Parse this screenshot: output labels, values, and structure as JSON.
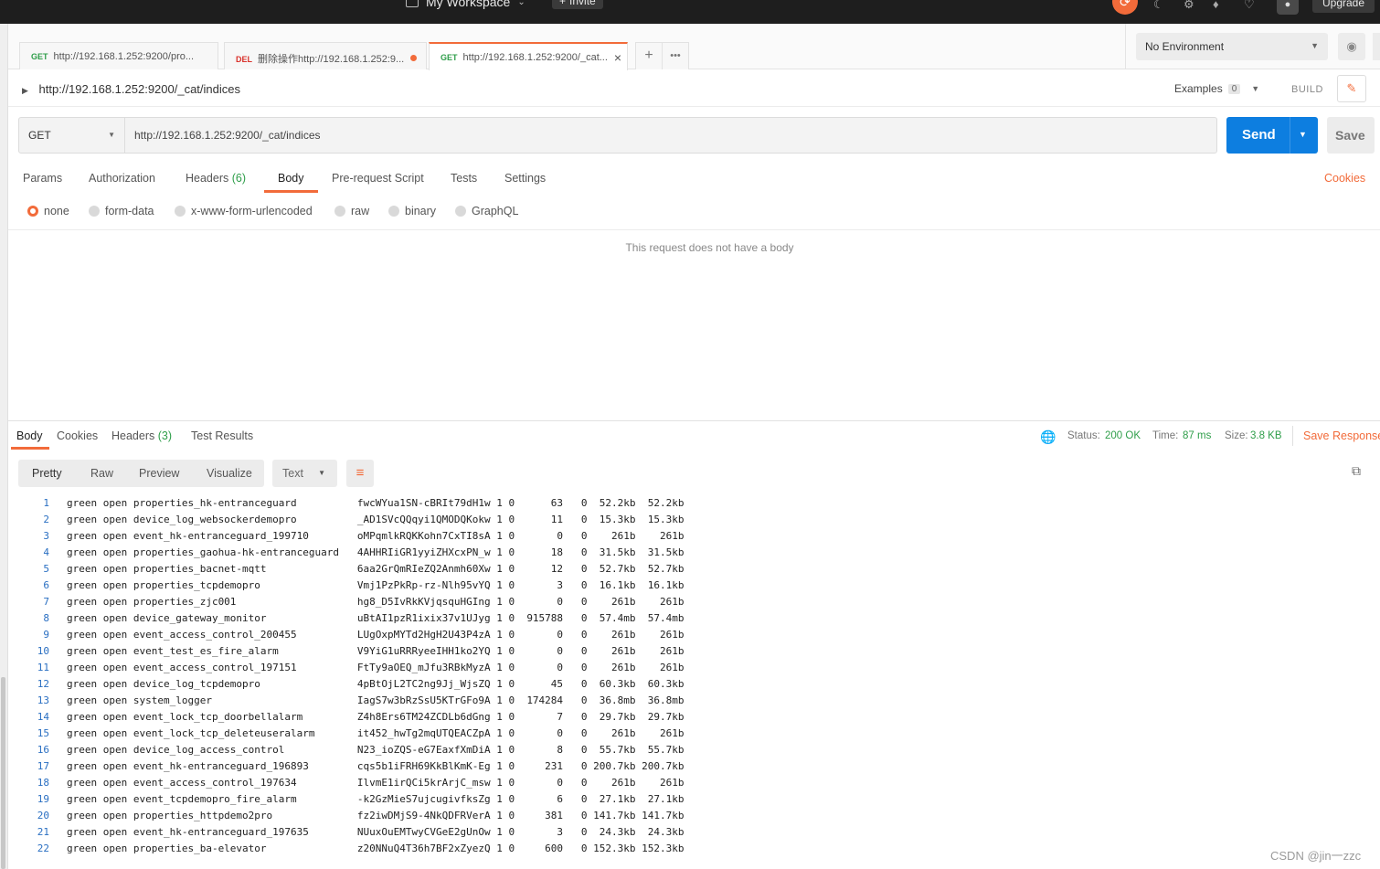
{
  "topbar": {
    "workspace": "My Workspace",
    "invite": "Invite",
    "upgrade": "Upgrade"
  },
  "tabs": [
    {
      "method": "GET",
      "title": "http://192.168.1.252:9200/pro..."
    },
    {
      "method": "DEL",
      "title": "删除操作http://192.168.1.252:9..."
    },
    {
      "method": "GET",
      "title": "http://192.168.1.252:9200/_cat..."
    }
  ],
  "environment": {
    "selected": "No Environment"
  },
  "request": {
    "name": "http://192.168.1.252:9200/_cat/indices",
    "examples_label": "Examples",
    "examples_count": "0",
    "build_label": "BUILD",
    "method": "GET",
    "url": "http://192.168.1.252:9200/_cat/indices",
    "send_label": "Send",
    "save_label": "Save"
  },
  "request_tabs": {
    "params": "Params",
    "authorization": "Authorization",
    "headers": "Headers",
    "headers_count": "(6)",
    "body": "Body",
    "prerequest": "Pre-request Script",
    "tests": "Tests",
    "settings": "Settings",
    "cookies": "Cookies"
  },
  "body_modes": {
    "none": "none",
    "form_data": "form-data",
    "urlencoded": "x-www-form-urlencoded",
    "raw": "raw",
    "binary": "binary",
    "graphql": "GraphQL",
    "selected": "none",
    "empty_message": "This request does not have a body"
  },
  "response_tabs": {
    "body": "Body",
    "cookies": "Cookies",
    "headers": "Headers",
    "headers_count": "(3)",
    "test_results": "Test Results"
  },
  "response_status": {
    "status_label": "Status:",
    "status_value": "200 OK",
    "time_label": "Time:",
    "time_value": "87 ms",
    "size_label": "Size:",
    "size_value": "3.8 KB",
    "save_response": "Save Response"
  },
  "format": {
    "pretty": "Pretty",
    "raw": "Raw",
    "preview": "Preview",
    "visualize": "Visualize",
    "text_mode": "Text"
  },
  "response_lines": [
    "green open properties_hk-entranceguard          fwcWYua1SN-cBRIt79dH1w 1 0      63   0  52.2kb  52.2kb",
    "green open device_log_websockerdemopro          _AD1SVcQQqyi1QMODQKokw 1 0      11   0  15.3kb  15.3kb",
    "green open event_hk-entranceguard_199710        oMPqmlkRQKKohn7CxTI8sA 1 0       0   0    261b    261b",
    "green open properties_gaohua-hk-entranceguard   4AHHRIiGR1yyiZHXcxPN_w 1 0      18   0  31.5kb  31.5kb",
    "green open properties_bacnet-mqtt               6aa2GrQmRIeZQ2Anmh60Xw 1 0      12   0  52.7kb  52.7kb",
    "green open properties_tcpdemopro                Vmj1PzPkRp-rz-Nlh95vYQ 1 0       3   0  16.1kb  16.1kb",
    "green open properties_zjc001                    hg8_D5IvRkKVjqsquHGIng 1 0       0   0    261b    261b",
    "green open device_gateway_monitor               uBtAI1pzR1ixix37v1UJyg 1 0  915788   0  57.4mb  57.4mb",
    "green open event_access_control_200455          LUgOxpMYTd2HgH2U43P4zA 1 0       0   0    261b    261b",
    "green open event_test_es_fire_alarm             V9YiG1uRRRyeeIHH1ko2YQ 1 0       0   0    261b    261b",
    "green open event_access_control_197151          FtTy9aOEQ_mJfu3RBkMyzA 1 0       0   0    261b    261b",
    "green open device_log_tcpdemopro                4pBtOjL2TC2ng9Jj_WjsZQ 1 0      45   0  60.3kb  60.3kb",
    "green open system_logger                        IagS7w3bRzSsU5KTrGFo9A 1 0  174284   0  36.8mb  36.8mb",
    "green open event_lock_tcp_doorbellalarm         Z4h8Ers6TM24ZCDLb6dGng 1 0       7   0  29.7kb  29.7kb",
    "green open event_lock_tcp_deleteuseralarm       it452_hwTg2mqUTQEACZpA 1 0       0   0    261b    261b",
    "green open device_log_access_control            N23_ioZQS-eG7EaxfXmDiA 1 0       8   0  55.7kb  55.7kb",
    "green open event_hk-entranceguard_196893        cqs5b1iFRH69KkBlKmK-Eg 1 0     231   0 200.7kb 200.7kb",
    "green open event_access_control_197634          IlvmE1irQCi5krArjC_msw 1 0       0   0    261b    261b",
    "green open event_tcpdemopro_fire_alarm          -k2GzMieS7ujcugivfksZg 1 0       6   0  27.1kb  27.1kb",
    "green open properties_httpdemo2pro              fz2iwDMjS9-4NkQDFRVerA 1 0     381   0 141.7kb 141.7kb",
    "green open event_hk-entranceguard_197635        NUuxOuEMTwyCVGeE2gUnOw 1 0       3   0  24.3kb  24.3kb",
    "green open properties_ba-elevator               z20NNuQ4T36h7BF2xZyezQ 1 0     600   0 152.3kb 152.3kb"
  ],
  "watermark": "CSDN @jin一zzc",
  "colors": {
    "accent": "#f26b3a",
    "send": "#0d7ee0",
    "get": "#2f9e4a",
    "del": "#d9312b",
    "status_ok": "#2f9e4a"
  }
}
